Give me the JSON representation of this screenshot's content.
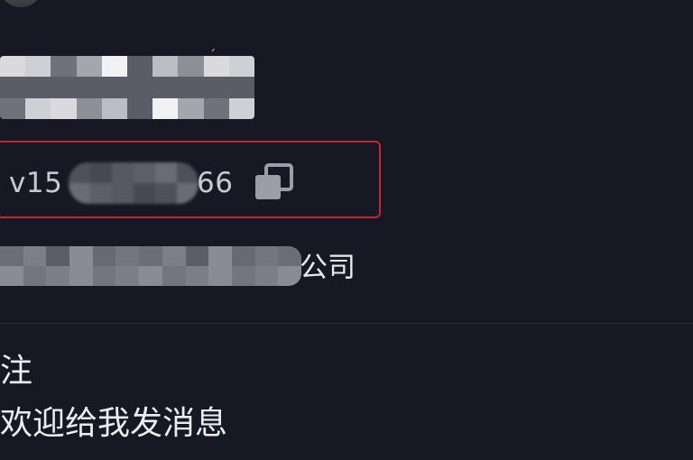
{
  "profile": {
    "id_prefix": "v15",
    "id_suffix": "66",
    "company_suffix": "公司",
    "name_partial_glyph": "ˊ"
  },
  "bio": {
    "line1": "注",
    "line2": "欢迎给我发消息"
  },
  "icons": {
    "copy": "copy-icon"
  },
  "colors": {
    "background": "#161823",
    "highlight_border": "#c32635",
    "primary_text": "#ececf2",
    "secondary_text": "#c7c8d0"
  }
}
